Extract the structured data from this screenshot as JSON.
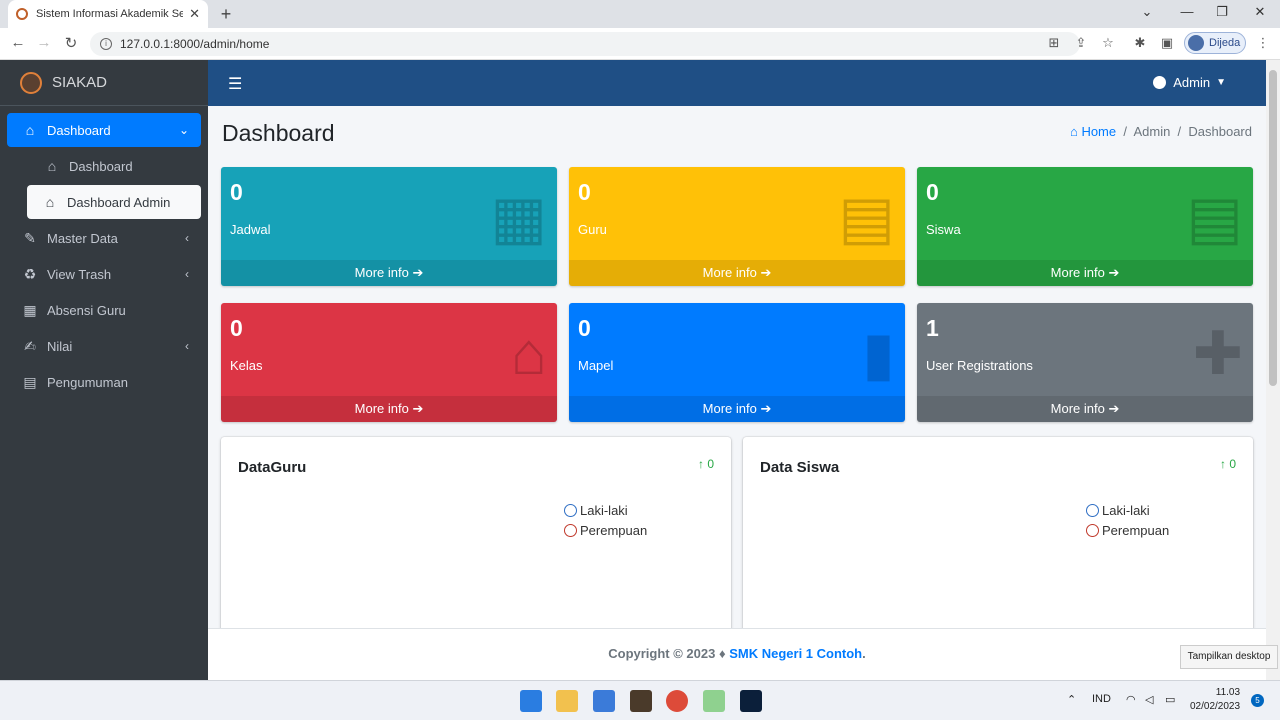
{
  "browser": {
    "tab_title": "Sistem Informasi Akademik Sekolah",
    "url": "127.0.0.1:8000/admin/home",
    "profile_name": "Dijeda"
  },
  "sidebar": {
    "brand": "SIAKAD",
    "items": [
      {
        "label": "Dashboard",
        "icon": "home-icon"
      },
      {
        "label": "Dashboard",
        "icon": "home-icon"
      },
      {
        "label": "Dashboard Admin",
        "icon": "home-icon"
      },
      {
        "label": "Master Data",
        "icon": "edit-icon"
      },
      {
        "label": "View Trash",
        "icon": "recycle-icon"
      },
      {
        "label": "Absensi Guru",
        "icon": "calendar-check-icon"
      },
      {
        "label": "Nilai",
        "icon": "signature-icon"
      },
      {
        "label": "Pengumuman",
        "icon": "clipboard-icon"
      }
    ]
  },
  "topnav": {
    "user": "Admin"
  },
  "page": {
    "title": "Dashboard",
    "breadcrumb": [
      "Home",
      "Admin",
      "Dashboard"
    ]
  },
  "boxes": [
    {
      "value": "0",
      "label": "Jadwal",
      "link": "More info",
      "color": "#17a2b8",
      "icon": "calendar-icon"
    },
    {
      "value": "0",
      "label": "Guru",
      "link": "More info",
      "color": "#ffc107",
      "icon": "id-card-icon"
    },
    {
      "value": "0",
      "label": "Siswa",
      "link": "More info",
      "color": "#28a745",
      "icon": "id-card-icon"
    },
    {
      "value": "0",
      "label": "Kelas",
      "link": "More info",
      "color": "#dc3545",
      "icon": "house-icon"
    },
    {
      "value": "0",
      "label": "Mapel",
      "link": "More info",
      "color": "#007bff",
      "icon": "book-icon"
    },
    {
      "value": "1",
      "label": "User Registrations",
      "link": "More info",
      "color": "#6c757d",
      "icon": "user-plus-icon"
    }
  ],
  "cards": [
    {
      "title": "DataGuru",
      "stat": "0",
      "legend": [
        "Laki-laki",
        "Perempuan"
      ]
    },
    {
      "title": "Data Siswa",
      "stat": "0",
      "legend": [
        "Laki-laki",
        "Perempuan"
      ]
    }
  ],
  "footer": {
    "copyright": "Copyright © 2023 ♦",
    "org": "SMK Negeri 1 Contoh",
    "dot": "."
  },
  "tooltip": "Tampilkan desktop",
  "taskbar": {
    "lang": "IND",
    "time": "11.03",
    "date": "02/02/2023",
    "notif": "5"
  }
}
